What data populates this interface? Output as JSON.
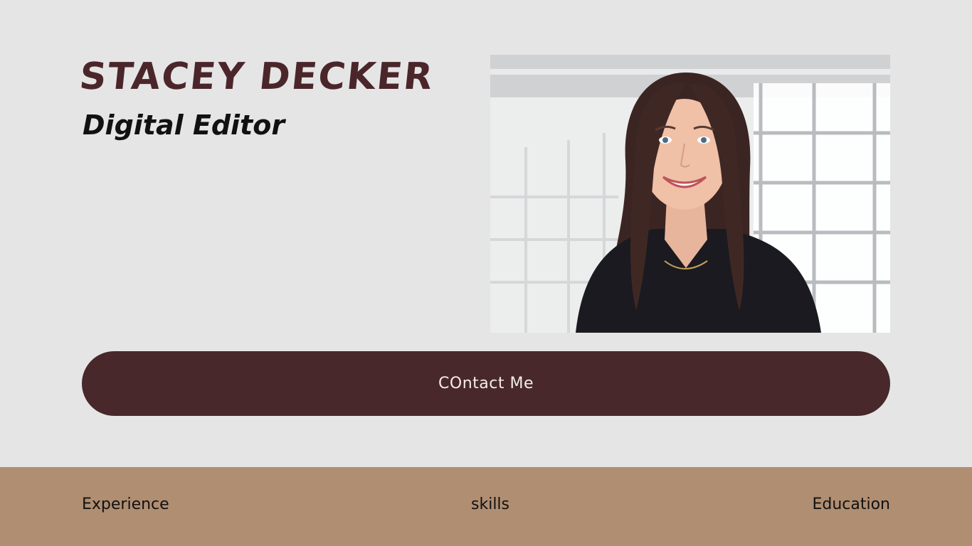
{
  "header": {
    "name": "STACEY DECKER",
    "role": "Digital Editor"
  },
  "profile_photo": {
    "alt": "Stacey Decker"
  },
  "contact": {
    "label": "COntact Me"
  },
  "footer_nav": {
    "items": [
      {
        "label": "Experience"
      },
      {
        "label": "skills"
      },
      {
        "label": "Education"
      }
    ]
  },
  "colors": {
    "background": "#e6e5e5",
    "accent_dark": "#48282b",
    "footer": "#b08e72"
  }
}
